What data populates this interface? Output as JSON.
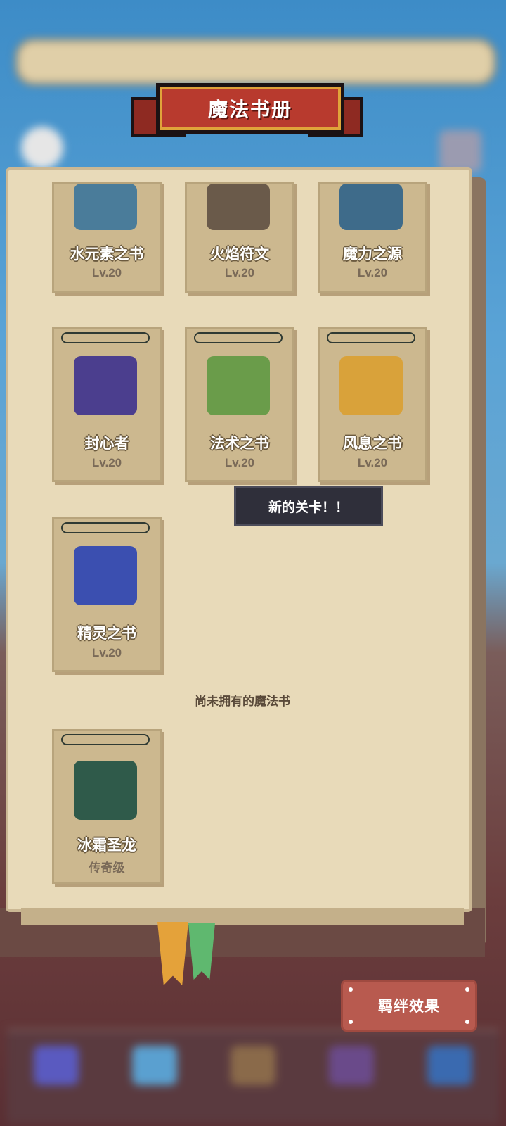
{
  "title": "魔法书册",
  "books_owned": [
    {
      "name": "水元素之书",
      "level": "Lv.20",
      "color": "#4a7c9a"
    },
    {
      "name": "火焰符文",
      "level": "Lv.20",
      "color": "#6a5a4a"
    },
    {
      "name": "魔力之源",
      "level": "Lv.20",
      "color": "#3e6b8a"
    },
    {
      "name": "封心者",
      "level": "Lv.20",
      "color": "#4b3e8e"
    },
    {
      "name": "法术之书",
      "level": "Lv.20",
      "color": "#6a9c4a"
    },
    {
      "name": "风息之书",
      "level": "Lv.20",
      "color": "#d9a23a"
    },
    {
      "name": "精灵之书",
      "level": "Lv.20",
      "color": "#3b4fb0"
    }
  ],
  "tooltip": "新的关卡！！",
  "unowned_section_label": "尚未拥有的魔法书",
  "books_unowned": [
    {
      "name": "冰霜圣龙",
      "rarity": "传奇级",
      "color": "#2f5a4a"
    }
  ],
  "bond_button": "羁绊效果",
  "colors": {
    "page": "#e8dab9",
    "card": "#ccb88f",
    "banner": "#b83a2e",
    "button": "#b85a4f"
  }
}
